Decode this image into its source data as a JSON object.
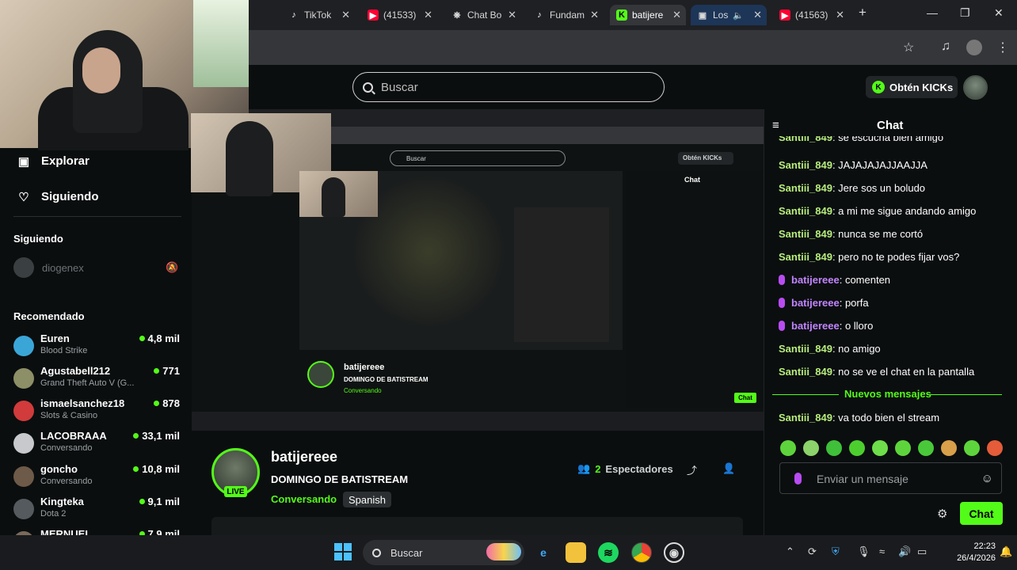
{
  "browser": {
    "tabs": [
      {
        "label": "TikTok"
      },
      {
        "label": "(41533)"
      },
      {
        "label": "Chat Bo"
      },
      {
        "label": "Fundam"
      },
      {
        "label": "batijere"
      },
      {
        "label": "Los"
      },
      {
        "label": "(41563)"
      }
    ],
    "new_tab": "+"
  },
  "header": {
    "search_placeholder": "Buscar",
    "get_kicks_label": "Obtén KICKs"
  },
  "sidebar": {
    "nav": [
      {
        "label": "Explorar",
        "icon": "explore-icon"
      },
      {
        "label": "Siguiendo",
        "icon": "heart-icon"
      }
    ],
    "following_title": "Siguiendo",
    "following": [
      {
        "name": "diogenex"
      }
    ],
    "recommended_title": "Recomendado",
    "recommended": [
      {
        "name": "Euren",
        "category": "Blood Strike",
        "viewers": "4,8 mil",
        "color": "#3aa6d8"
      },
      {
        "name": "Agustabell212",
        "category": "Grand Theft Auto V (G...",
        "viewers": "771",
        "color": "#8d8f66"
      },
      {
        "name": "ismaelsanchez18",
        "category": "Slots & Casino",
        "viewers": "878",
        "color": "#d13b3b"
      },
      {
        "name": "LACOBRAAA",
        "category": "Conversando",
        "viewers": "33,1 mil",
        "color": "#c7c9cc"
      },
      {
        "name": "goncho",
        "category": "Conversando",
        "viewers": "10,8 mil",
        "color": "#6d5a48"
      },
      {
        "name": "Kingteka",
        "category": "Dota 2",
        "viewers": "9,1 mil",
        "color": "#555a5e"
      },
      {
        "name": "MERNUEL",
        "category": "",
        "viewers": "7,9 mil",
        "color": "#7a6a5a"
      }
    ]
  },
  "stream": {
    "channel": "batijereee",
    "title": "DOMINGO DE BATISTREAM",
    "category": "Conversando",
    "language": "Spanish",
    "live_badge": "LIVE",
    "viewers_count": "2",
    "viewers_label": "Espectadores"
  },
  "chat": {
    "title": "Chat",
    "messages": [
      {
        "user": "Santiii_849",
        "text": "se escucha bien amigo",
        "style": "green"
      },
      {
        "user": "Santiii_849",
        "text": "JAJAJAJAJJAAJJA",
        "style": "green"
      },
      {
        "user": "Santiii_849",
        "text": "Jere sos un boludo",
        "style": "green"
      },
      {
        "user": "Santiii_849",
        "text": "a mi me sigue andando amigo",
        "style": "green"
      },
      {
        "user": "Santiii_849",
        "text": "nunca se me cortó",
        "style": "green"
      },
      {
        "user": "Santiii_849",
        "text": "pero no te podes fijar vos?",
        "style": "green"
      },
      {
        "user": "batijereee",
        "text": "comenten",
        "style": "purple"
      },
      {
        "user": "batijereee",
        "text": "porfa",
        "style": "purple"
      },
      {
        "user": "batijereee",
        "text": "o lloro",
        "style": "purple"
      },
      {
        "user": "Santiii_849",
        "text": "no amigo",
        "style": "green"
      },
      {
        "user": "Santiii_849",
        "text": "no se ve el chat en la pantalla",
        "style": "green"
      }
    ],
    "new_messages_label": "Nuevos mensajes",
    "after_new": [
      {
        "user": "Santiii_849",
        "text": "va todo bien el stream",
        "style": "green"
      }
    ],
    "input_placeholder": "Enviar un mensaje",
    "send_label": "Chat"
  },
  "taskbar": {
    "search_label": "Buscar",
    "time": "22:23",
    "date": "26/4/2026"
  },
  "colors": {
    "accent": "#53fc18",
    "background": "#0b0e0f",
    "mod_badge": "#b84cf2"
  }
}
